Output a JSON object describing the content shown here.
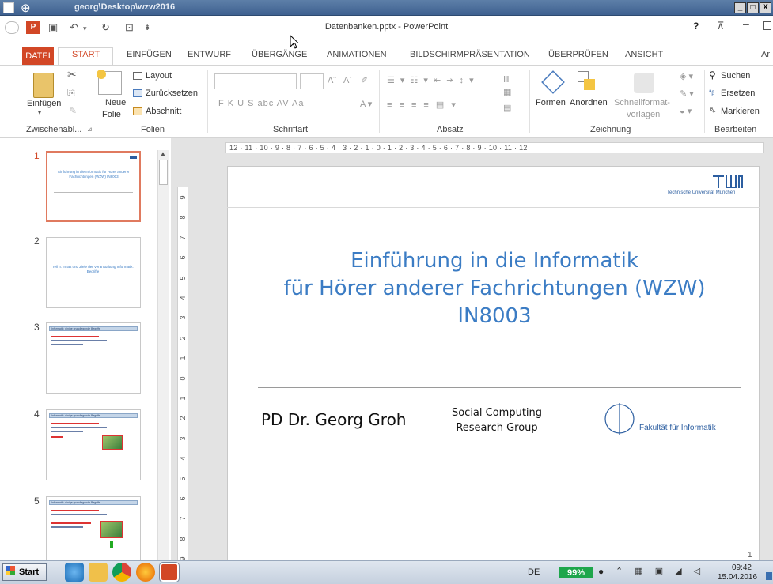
{
  "explorer": {
    "path": "georg\\Desktop\\wzw2016",
    "controls": [
      "_",
      "□",
      "X"
    ]
  },
  "window": {
    "title": "Datenbanken.pptx - PowerPoint",
    "help": "?",
    "cut_label": "Ar"
  },
  "tabs": [
    "DATEI",
    "START",
    "EINFÜGEN",
    "ENTWURF",
    "ÜBERGÄNGE",
    "ANIMATIONEN",
    "BILDSCHIRMPRÄSENTATION",
    "ÜBERPRÜFEN",
    "ANSICHT"
  ],
  "ribbon": {
    "paste": "Einfügen",
    "new_slide_1": "Neue",
    "new_slide_2": "Folie",
    "layout": "Layout",
    "reset": "Zurücksetzen",
    "section": "Abschnitt",
    "font_btns": "F  K  U  S  abc  AV  Aa",
    "shapes": "Formen",
    "arrange": "Anordnen",
    "quick_styles_1": "Schnellformat-",
    "quick_styles_2": "vorlagen",
    "find": "Suchen",
    "replace": "Ersetzen",
    "select": "Markieren",
    "groups": {
      "clipboard": "Zwischenabl...",
      "slides": "Folien",
      "font": "Schriftart",
      "paragraph": "Absatz",
      "drawing": "Zeichnung",
      "editing": "Bearbeiten"
    }
  },
  "thumbnails": [
    {
      "num": "1",
      "text": "Einführung in die Informatik für Hörer anderer Fachrichtungen (WZW) IN8003"
    },
    {
      "num": "2",
      "text": "Teil II: Inhalt und Ziele der Veranstaltung Informatik: Begriffe"
    },
    {
      "num": "3",
      "text": "Informatik: einige grundlegende Begriffe"
    },
    {
      "num": "4",
      "text": "Informatik: einige grundlegende Begriffe"
    },
    {
      "num": "5",
      "text": "Informatik: einige grundlegende Begriffe"
    }
  ],
  "ruler": {
    "h": "12 · 11 · 10 · 9 · 8 · 7 · 6 · 5 · 4 · 3 · 2 · 1 · 0 · 1 · 2 · 3 · 4 · 5 · 6 · 7 · 8 · 9 · 10 · 11 · 12",
    "v": [
      "9",
      "8",
      "7",
      "6",
      "5",
      "4",
      "3",
      "2",
      "1",
      "0",
      "1",
      "2",
      "3",
      "4",
      "5",
      "6",
      "7",
      "8",
      "9"
    ]
  },
  "slide": {
    "title_1": "Einführung in die Informatik",
    "title_2": "für Hörer anderer Fachrichtungen (WZW)",
    "title_3": "IN8003",
    "author": "PD Dr. Georg Groh",
    "group_1": "Social Computing",
    "group_2": "Research Group",
    "faculty": "Fakultät für Informatik",
    "tum_sub": "Technische Universität München",
    "page": "1"
  },
  "taskbar": {
    "start": "Start",
    "lang": "DE",
    "battery": "99%",
    "time": "09:42",
    "date": "15.04.2016"
  },
  "colors": {
    "accent": "#d24726",
    "title_blue": "#3b7cc4",
    "battery": "#1ea64b"
  }
}
